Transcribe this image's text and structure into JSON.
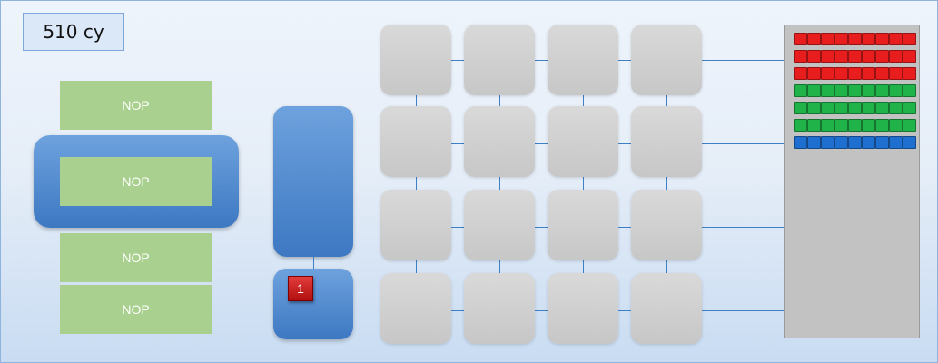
{
  "cycle_counter": {
    "label": "510 cy"
  },
  "instructions": [
    {
      "label": "NOP"
    },
    {
      "label": "NOP"
    },
    {
      "label": "NOP"
    },
    {
      "label": "NOP"
    }
  ],
  "badge": {
    "label": "1"
  },
  "register_rows": [
    {
      "color": "#e81d1d"
    },
    {
      "color": "#e81d1d"
    },
    {
      "color": "#e81d1d"
    },
    {
      "color": "#1fb34a"
    },
    {
      "color": "#1fb34a"
    },
    {
      "color": "#1fb34a"
    },
    {
      "color": "#1f6fd0"
    }
  ],
  "registers_per_row": 9,
  "grid": {
    "rows": 4,
    "cols": 4
  }
}
